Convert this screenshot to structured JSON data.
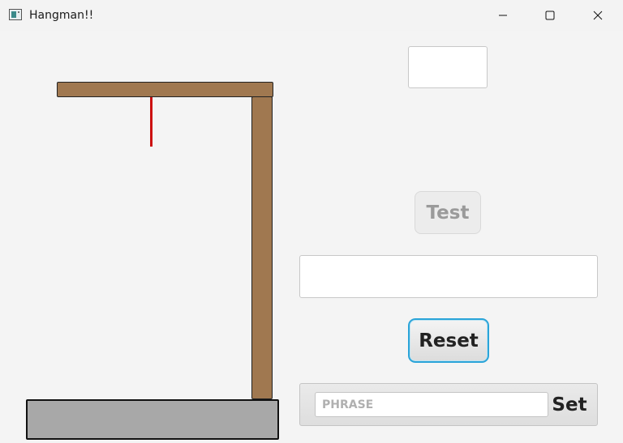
{
  "window": {
    "title": "Hangman!!",
    "controls": [
      "minimize-icon",
      "maximize-icon",
      "close-icon"
    ]
  },
  "gallows": {
    "beam_color": "#a07850",
    "post_color": "#a07850",
    "rope_color": "#cc1111",
    "base_color": "#a8a8a8"
  },
  "controls": {
    "guess_value": "",
    "test_label": "Test",
    "phrase_display_value": "",
    "reset_label": "Reset",
    "phrase_input_value": "",
    "phrase_input_placeholder": "PHRASE",
    "set_label": "Set"
  },
  "colors": {
    "focus_ring": "#2aa4d8"
  }
}
